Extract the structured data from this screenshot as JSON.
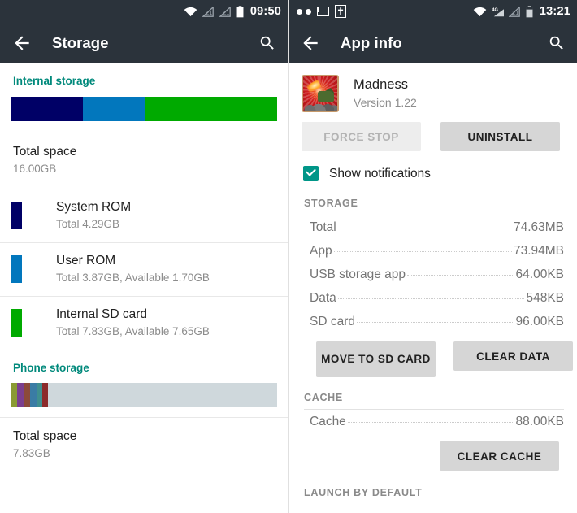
{
  "left": {
    "statusbar": {
      "icons_left": [],
      "icons_right": [
        "wifi-icon",
        "signal-icon",
        "signal-icon",
        "battery-icon"
      ],
      "clock": "09:50"
    },
    "toolbar": {
      "back_icon": "back-arrow-icon",
      "title": "Storage",
      "search_icon": "search-icon"
    },
    "internal": {
      "section_label": "Internal storage",
      "bar": {
        "segments": [
          {
            "name": "System ROM",
            "color": "#000066",
            "percent": 27
          },
          {
            "name": "User ROM",
            "color": "#0277bd",
            "percent": 23.6
          },
          {
            "name": "Internal SD card",
            "color": "#00aa00",
            "percent": 49.4
          }
        ]
      },
      "total": {
        "label": "Total space",
        "value": "16.00GB"
      },
      "volumes": [
        {
          "color": "#000066",
          "title": "System ROM",
          "sub": "Total 4.29GB"
        },
        {
          "color": "#0277bd",
          "title": "User ROM",
          "sub": "Total 3.87GB, Available 1.70GB"
        },
        {
          "color": "#00aa00",
          "title": "Internal SD card",
          "sub": "Total 7.83GB, Available 7.65GB"
        }
      ]
    },
    "phone": {
      "section_label": "Phone storage",
      "bar": {
        "track_color": "#cfd8dc",
        "segments": [
          {
            "color": "#8a9a33",
            "percent": 2.1
          },
          {
            "color": "#7b3f8f",
            "percent": 2.8
          },
          {
            "color": "#8c4a3a",
            "percent": 2.1
          },
          {
            "color": "#3a7ca5",
            "percent": 2.4
          },
          {
            "color": "#3f8f8f",
            "percent": 2.1
          },
          {
            "color": "#8c2b2b",
            "percent": 2.2
          }
        ]
      },
      "total": {
        "label": "Total space",
        "value": "7.83GB"
      }
    }
  },
  "right": {
    "statusbar": {
      "icons_left": [
        "two-dots-icon",
        "gmail-icon",
        "bible-app-icon"
      ],
      "icons_right": [
        "wifi-icon",
        "signal-4g-icon",
        "signal-icon",
        "battery-icon"
      ],
      "signal_label": "4G",
      "clock": "13:21"
    },
    "toolbar": {
      "back_icon": "back-arrow-icon",
      "title": "App info",
      "search_icon": "search-icon"
    },
    "app": {
      "icon": "madness-app-icon",
      "name": "Madness",
      "version": "Version 1.22"
    },
    "actions": {
      "force_stop": "FORCE STOP",
      "force_stop_enabled": false,
      "uninstall": "UNINSTALL",
      "uninstall_enabled": true
    },
    "notifications": {
      "label": "Show notifications",
      "checked": true,
      "accent": "#009688"
    },
    "storage": {
      "header": "STORAGE",
      "rows": [
        {
          "key": "Total",
          "value": "74.63MB"
        },
        {
          "key": "App",
          "value": "73.94MB"
        },
        {
          "key": "USB storage app",
          "value": "64.00KB"
        },
        {
          "key": "Data",
          "value": "548KB"
        },
        {
          "key": "SD card",
          "value": "96.00KB"
        }
      ],
      "buttons": {
        "move_to_sd": "MOVE TO SD CARD",
        "clear_data": "CLEAR DATA"
      }
    },
    "cache": {
      "header": "CACHE",
      "rows": [
        {
          "key": "Cache",
          "value": "88.00KB"
        }
      ],
      "buttons": {
        "clear_cache": "CLEAR CACHE"
      }
    },
    "launch": {
      "header": "LAUNCH BY DEFAULT"
    }
  }
}
